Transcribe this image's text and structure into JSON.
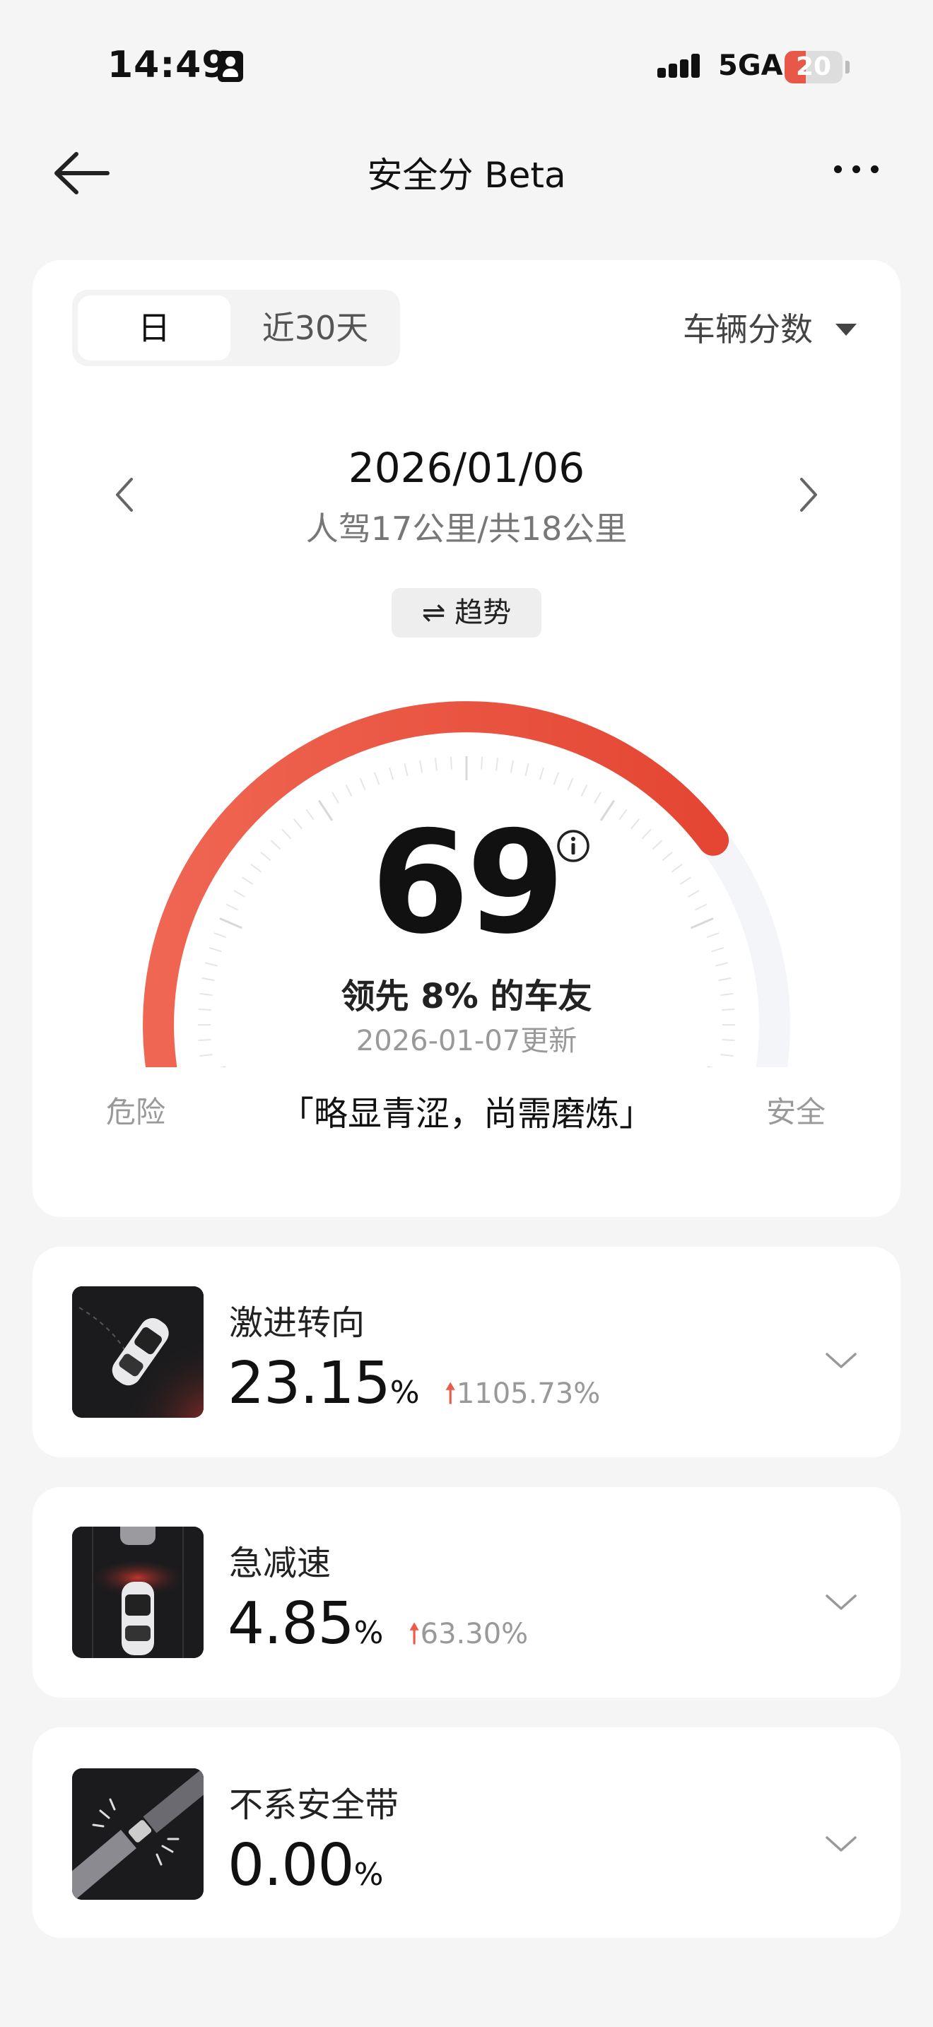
{
  "status_bar": {
    "time": "14:49",
    "network": "5GA",
    "battery": "20"
  },
  "header": {
    "title": "安全分 Beta"
  },
  "tabs": {
    "day": "日",
    "last30": "近30天"
  },
  "score_selector": "车辆分数",
  "date_nav": {
    "date": "2026/01/06",
    "distance": "人驾17公里/共18公里"
  },
  "trend_button": "⇌ 趋势",
  "gauge": {
    "score": "69",
    "score_fraction": 0.69,
    "lead": "领先 8% 的车友",
    "updated": "2026-01-07更新",
    "left_label": "危险",
    "right_label": "安全",
    "comment": "「略显青涩，尚需磨炼」"
  },
  "metrics": [
    {
      "title": "激进转向",
      "value": "23.15",
      "unit": "%",
      "change": "1105.73%",
      "icon": "aggressive-turn-icon"
    },
    {
      "title": "急减速",
      "value": "4.85",
      "unit": "%",
      "change": "63.30%",
      "icon": "hard-braking-icon"
    },
    {
      "title": "不系安全带",
      "value": "0.00",
      "unit": "%",
      "change": "",
      "icon": "seatbelt-icon"
    }
  ],
  "colors": {
    "accent": "#e9513f",
    "gauge_start": "#ef6652",
    "gauge_end": "#e44633",
    "background": "#f5f5f5"
  }
}
